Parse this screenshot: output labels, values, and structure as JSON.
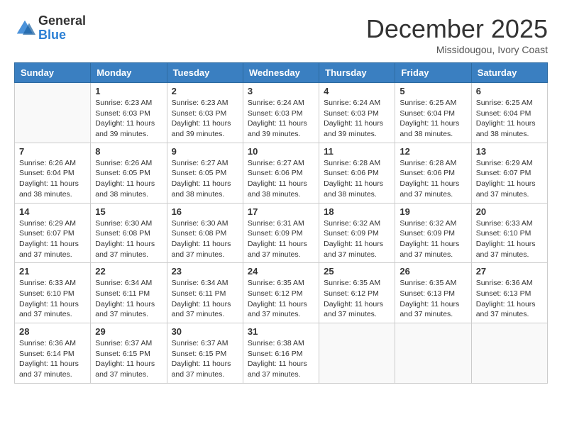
{
  "header": {
    "logo_general": "General",
    "logo_blue": "Blue",
    "title": "December 2025",
    "subtitle": "Missidougou, Ivory Coast"
  },
  "days_of_week": [
    "Sunday",
    "Monday",
    "Tuesday",
    "Wednesday",
    "Thursday",
    "Friday",
    "Saturday"
  ],
  "weeks": [
    [
      {
        "day": "",
        "info": ""
      },
      {
        "day": "1",
        "info": "Sunrise: 6:23 AM\nSunset: 6:03 PM\nDaylight: 11 hours\nand 39 minutes."
      },
      {
        "day": "2",
        "info": "Sunrise: 6:23 AM\nSunset: 6:03 PM\nDaylight: 11 hours\nand 39 minutes."
      },
      {
        "day": "3",
        "info": "Sunrise: 6:24 AM\nSunset: 6:03 PM\nDaylight: 11 hours\nand 39 minutes."
      },
      {
        "day": "4",
        "info": "Sunrise: 6:24 AM\nSunset: 6:03 PM\nDaylight: 11 hours\nand 39 minutes."
      },
      {
        "day": "5",
        "info": "Sunrise: 6:25 AM\nSunset: 6:04 PM\nDaylight: 11 hours\nand 38 minutes."
      },
      {
        "day": "6",
        "info": "Sunrise: 6:25 AM\nSunset: 6:04 PM\nDaylight: 11 hours\nand 38 minutes."
      }
    ],
    [
      {
        "day": "7",
        "info": "Sunrise: 6:26 AM\nSunset: 6:04 PM\nDaylight: 11 hours\nand 38 minutes."
      },
      {
        "day": "8",
        "info": "Sunrise: 6:26 AM\nSunset: 6:05 PM\nDaylight: 11 hours\nand 38 minutes."
      },
      {
        "day": "9",
        "info": "Sunrise: 6:27 AM\nSunset: 6:05 PM\nDaylight: 11 hours\nand 38 minutes."
      },
      {
        "day": "10",
        "info": "Sunrise: 6:27 AM\nSunset: 6:06 PM\nDaylight: 11 hours\nand 38 minutes."
      },
      {
        "day": "11",
        "info": "Sunrise: 6:28 AM\nSunset: 6:06 PM\nDaylight: 11 hours\nand 38 minutes."
      },
      {
        "day": "12",
        "info": "Sunrise: 6:28 AM\nSunset: 6:06 PM\nDaylight: 11 hours\nand 37 minutes."
      },
      {
        "day": "13",
        "info": "Sunrise: 6:29 AM\nSunset: 6:07 PM\nDaylight: 11 hours\nand 37 minutes."
      }
    ],
    [
      {
        "day": "14",
        "info": "Sunrise: 6:29 AM\nSunset: 6:07 PM\nDaylight: 11 hours\nand 37 minutes."
      },
      {
        "day": "15",
        "info": "Sunrise: 6:30 AM\nSunset: 6:08 PM\nDaylight: 11 hours\nand 37 minutes."
      },
      {
        "day": "16",
        "info": "Sunrise: 6:30 AM\nSunset: 6:08 PM\nDaylight: 11 hours\nand 37 minutes."
      },
      {
        "day": "17",
        "info": "Sunrise: 6:31 AM\nSunset: 6:09 PM\nDaylight: 11 hours\nand 37 minutes."
      },
      {
        "day": "18",
        "info": "Sunrise: 6:32 AM\nSunset: 6:09 PM\nDaylight: 11 hours\nand 37 minutes."
      },
      {
        "day": "19",
        "info": "Sunrise: 6:32 AM\nSunset: 6:09 PM\nDaylight: 11 hours\nand 37 minutes."
      },
      {
        "day": "20",
        "info": "Sunrise: 6:33 AM\nSunset: 6:10 PM\nDaylight: 11 hours\nand 37 minutes."
      }
    ],
    [
      {
        "day": "21",
        "info": "Sunrise: 6:33 AM\nSunset: 6:10 PM\nDaylight: 11 hours\nand 37 minutes."
      },
      {
        "day": "22",
        "info": "Sunrise: 6:34 AM\nSunset: 6:11 PM\nDaylight: 11 hours\nand 37 minutes."
      },
      {
        "day": "23",
        "info": "Sunrise: 6:34 AM\nSunset: 6:11 PM\nDaylight: 11 hours\nand 37 minutes."
      },
      {
        "day": "24",
        "info": "Sunrise: 6:35 AM\nSunset: 6:12 PM\nDaylight: 11 hours\nand 37 minutes."
      },
      {
        "day": "25",
        "info": "Sunrise: 6:35 AM\nSunset: 6:12 PM\nDaylight: 11 hours\nand 37 minutes."
      },
      {
        "day": "26",
        "info": "Sunrise: 6:35 AM\nSunset: 6:13 PM\nDaylight: 11 hours\nand 37 minutes."
      },
      {
        "day": "27",
        "info": "Sunrise: 6:36 AM\nSunset: 6:13 PM\nDaylight: 11 hours\nand 37 minutes."
      }
    ],
    [
      {
        "day": "28",
        "info": "Sunrise: 6:36 AM\nSunset: 6:14 PM\nDaylight: 11 hours\nand 37 minutes."
      },
      {
        "day": "29",
        "info": "Sunrise: 6:37 AM\nSunset: 6:15 PM\nDaylight: 11 hours\nand 37 minutes."
      },
      {
        "day": "30",
        "info": "Sunrise: 6:37 AM\nSunset: 6:15 PM\nDaylight: 11 hours\nand 37 minutes."
      },
      {
        "day": "31",
        "info": "Sunrise: 6:38 AM\nSunset: 6:16 PM\nDaylight: 11 hours\nand 37 minutes."
      },
      {
        "day": "",
        "info": ""
      },
      {
        "day": "",
        "info": ""
      },
      {
        "day": "",
        "info": ""
      }
    ]
  ]
}
